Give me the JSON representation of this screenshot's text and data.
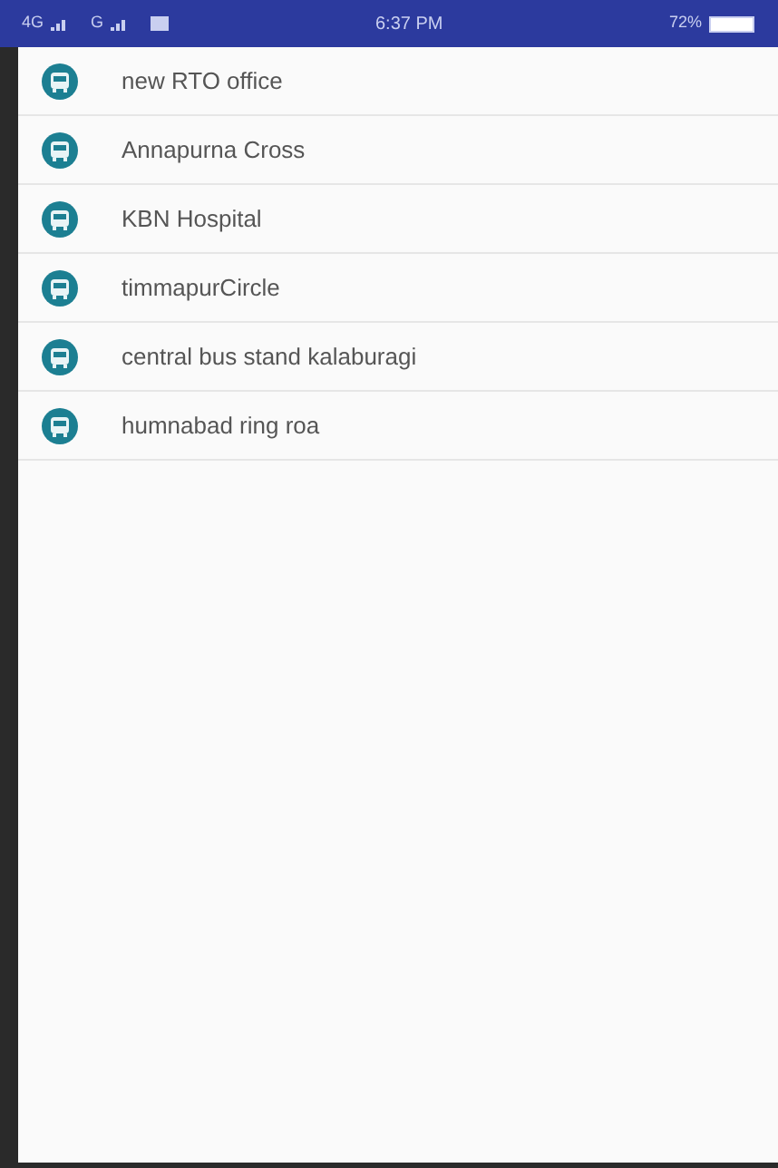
{
  "status_bar": {
    "network_1": "4G",
    "network_2": "G",
    "time": "6:37 PM",
    "battery": "72%"
  },
  "stops": [
    {
      "name": "new RTO office"
    },
    {
      "name": "Annapurna Cross"
    },
    {
      "name": "KBN Hospital"
    },
    {
      "name": "timmapurCircle"
    },
    {
      "name": "central bus stand kalaburagi"
    },
    {
      "name": "humnabad ring roa"
    }
  ]
}
